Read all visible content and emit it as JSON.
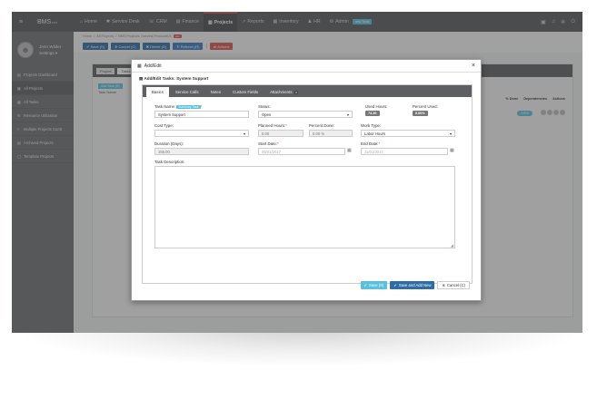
{
  "nav": {
    "brand": "BMS",
    "brand_suffix": ".net",
    "items": [
      {
        "icon": "⌂",
        "label": "Home"
      },
      {
        "icon": "✱",
        "label": "Service Desk"
      },
      {
        "icon": "☏",
        "label": "CRM"
      },
      {
        "icon": "▤",
        "label": "Finance"
      },
      {
        "icon": "▥",
        "label": "Projects"
      },
      {
        "icon": "↗",
        "label": "Reports"
      },
      {
        "icon": "▦",
        "label": "Inventory"
      },
      {
        "icon": "♟",
        "label": "HR"
      },
      {
        "icon": "⚙",
        "label": "Admin"
      }
    ],
    "badge": "new Tools"
  },
  "sidebar": {
    "user_name": "Jenn Wilder",
    "user_sub": "Settings ▾",
    "items": [
      {
        "icon": "▤",
        "label": "Projects Dashboard"
      },
      {
        "icon": "▦",
        "label": "All Projects"
      },
      {
        "icon": "▦",
        "label": "All Tasks"
      },
      {
        "icon": "⚙",
        "label": "Resource Utilization"
      },
      {
        "icon": "≡",
        "label": "Multiple Projects Gantt"
      },
      {
        "icon": "▤",
        "label": "Archived Projects"
      },
      {
        "icon": "▢",
        "label": "Template Projects"
      }
    ]
  },
  "breadcrumb": {
    "home": "Home",
    "projects": "All Projects",
    "current": "BMS Projects: Harvest Products01",
    "badge": "edit"
  },
  "toolbar": {
    "save": "Save (S)",
    "cancel": "Cancel (C)",
    "delete": "Delete (D)",
    "refresh": "Refresh (R)",
    "actions": "Actions"
  },
  "background": {
    "tab_project": "Project",
    "tab_tasks": "Tasks",
    "add_task": "Add Task (N)",
    "col_done": "% Done",
    "col_deps": "Dependencies",
    "col_actions": "Actions",
    "row_pct": "0.00%",
    "col_task": "Task Name",
    "row_label": "1 ✚ ⊖"
  },
  "modal": {
    "title": "Add/Edit",
    "section": "Add/Edit Tasks: System Support",
    "tabs": [
      "Basics",
      "Service Calls",
      "Notes",
      "Custom Fields",
      "Attachments"
    ],
    "attach_count": "0",
    "task_name_label": "Task Name:",
    "task_name_tag": "Summary Task",
    "task_name_value": "System Support",
    "status_label": "Status:",
    "status_value": "Open",
    "used_hours_label": "Used Hours:",
    "used_hours_value": "74.30",
    "percent_used_label": "Percent Used:",
    "percent_used_value": "0.00%",
    "cost_type_label": "Cost Type:",
    "cost_type_value": "",
    "planned_hours_label": "Planned Hours:",
    "planned_hours_value": "0.00",
    "percent_done_label": "Percent Done:",
    "percent_done_value": "0.00 %",
    "work_type_label": "Work Type:",
    "work_type_value": "Labor Hours",
    "duration_label": "Duration (Days):",
    "duration_value": "155.00",
    "start_date_label": "Start Date:",
    "start_date_value": "06/01/2017",
    "end_date_label": "End Date:",
    "end_date_value": "11/01/2017",
    "description_label": "Task Description:",
    "btn_save": "Save (S)",
    "btn_save_add": "Save and Add New",
    "btn_cancel": "Cancel (C)"
  },
  "colors": {
    "nav_bg": "#585a5d",
    "sidebar_bg": "#6d6f72",
    "accent_blue": "#5bc0de",
    "primary_blue": "#2e6da4",
    "danger_red": "#d9534f"
  }
}
